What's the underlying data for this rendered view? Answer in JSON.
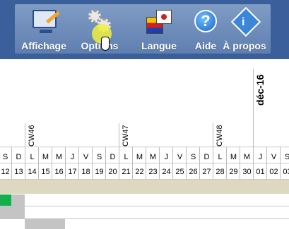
{
  "toolbar": {
    "buttons": [
      {
        "label": "Affichage",
        "icon": "monitor-icon"
      },
      {
        "label": "Options",
        "icon": "gears-icon"
      },
      {
        "label": "Langue",
        "icon": "flags-icon"
      },
      {
        "label": "Aide",
        "icon": "help-icon"
      },
      {
        "label": "À propos",
        "icon": "info-icon"
      }
    ]
  },
  "calendar": {
    "month_label": "déc-16",
    "weeks": [
      "CW46",
      "CW47",
      "CW48"
    ],
    "day_letters": [
      "S",
      "D",
      "L",
      "M",
      "M",
      "J",
      "V",
      "S",
      "D",
      "L",
      "M",
      "M",
      "J",
      "V",
      "S",
      "D",
      "L",
      "M",
      "M",
      "J",
      "V",
      "S"
    ],
    "day_numbers": [
      "12",
      "13",
      "14",
      "15",
      "16",
      "17",
      "18",
      "19",
      "20",
      "21",
      "22",
      "23",
      "24",
      "25",
      "26",
      "27",
      "28",
      "29",
      "30",
      "01",
      "02",
      "03"
    ]
  },
  "colors": {
    "toolbar_bg": "#3a5f9a",
    "week_band": "#ddd8c2",
    "green_task": "#11b04a",
    "grey_task": "#c4c4c4"
  }
}
